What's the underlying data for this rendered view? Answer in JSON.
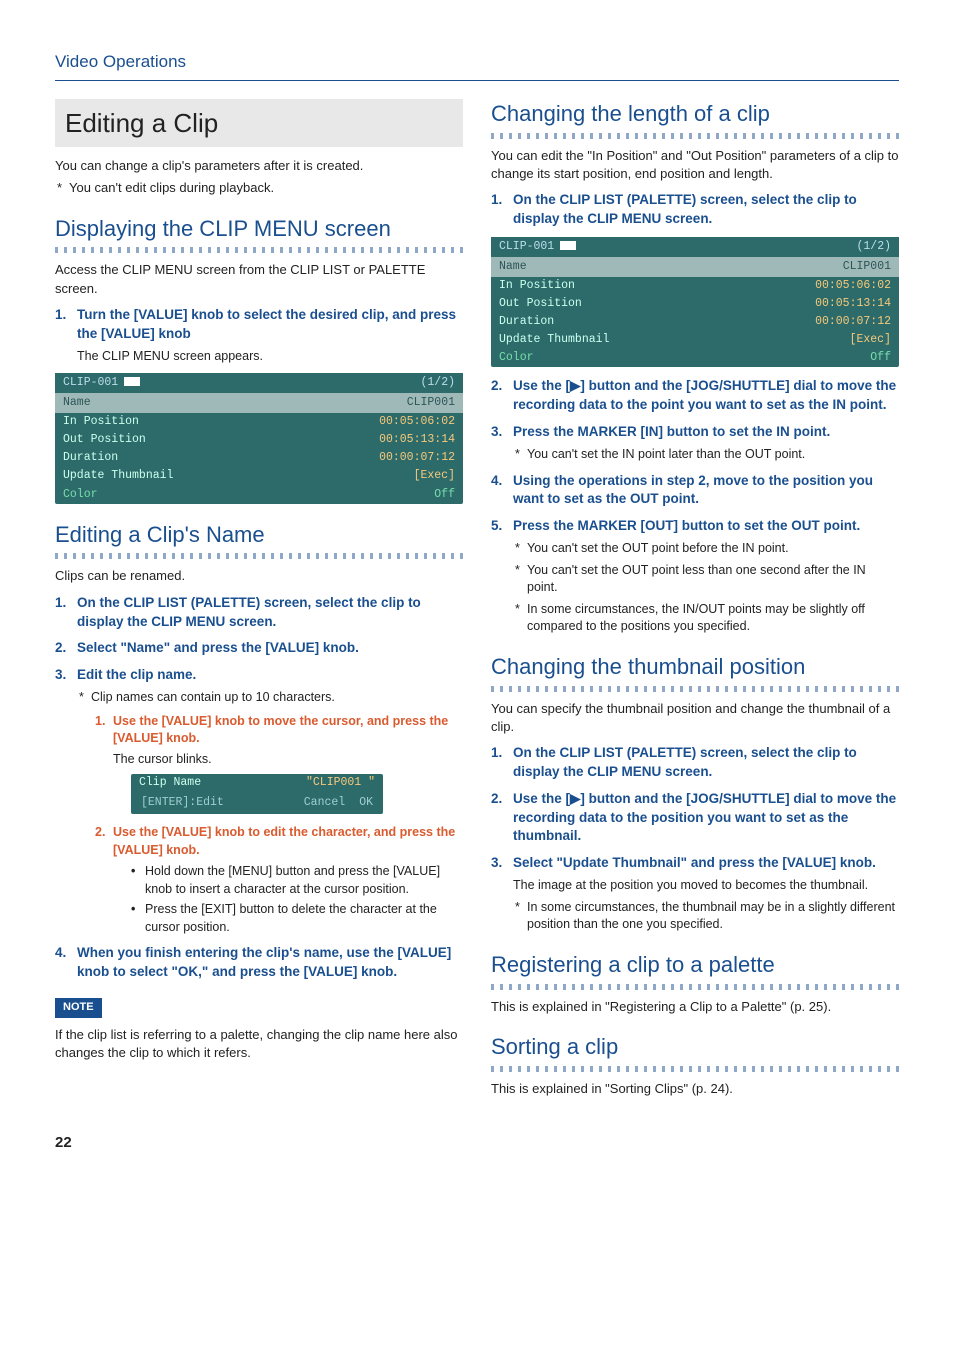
{
  "breadcrumb": "Video Operations",
  "h1": "Editing a Clip",
  "intro": "You can change a clip's parameters after it is created.",
  "intro_note": "You can't edit clips during playback.",
  "sec_display": {
    "title": "Displaying the CLIP MENU screen",
    "body": "Access the CLIP MENU screen from the CLIP LIST or PALETTE screen.",
    "step1": "Turn the [VALUE] knob to select the desired clip, and press the [VALUE] knob",
    "step1_sub": "The CLIP MENU screen appears."
  },
  "clipmenu": {
    "hdr_left": "CLIP-001",
    "hdr_right": "(1/2)",
    "name_l": "Name",
    "name_r": "CLIP001",
    "rows": [
      {
        "l": "In Position",
        "r": "00:05:06:02"
      },
      {
        "l": "Out Position",
        "r": "00:05:13:14"
      },
      {
        "l": "Duration",
        "r": "00:00:07:12"
      },
      {
        "l": "Update Thumbnail",
        "r": "[Exec]"
      },
      {
        "l": "Color",
        "r": "Off"
      }
    ]
  },
  "sec_name": {
    "title": "Editing a Clip's Name",
    "body": "Clips can be renamed.",
    "steps": [
      "On the CLIP LIST (PALETTE) screen, select the clip to display the CLIP MENU screen.",
      "Select \"Name\" and press the [VALUE] knob.",
      "Edit the clip name."
    ],
    "step3_note": "Clip names can contain up to 10 characters.",
    "sub1": "Use the [VALUE] knob to move the cursor, and press the [VALUE] knob.",
    "sub1_body": "The cursor blinks.",
    "sub2": "Use the [VALUE] knob to edit the character, and press the [VALUE] knob.",
    "sub2_b1": "Hold down the [MENU] button and press the [VALUE] knob to insert a character at the cursor position.",
    "sub2_b2": "Press the [EXIT] button to delete the character at the cursor position.",
    "step4": "When you finish entering the clip's name, use the [VALUE] knob to select \"OK,\" and press the [VALUE] knob.",
    "note_body": "If the clip list is referring to a palette, changing the clip name here also changes the clip to which it refers."
  },
  "nameedit": {
    "row_l": "Clip Name",
    "row_r": "\"CLIP001   \"",
    "btn_left": "[ENTER]:Edit",
    "btn_cancel": "Cancel",
    "btn_ok": "OK"
  },
  "sec_len": {
    "title": "Changing the length of a clip",
    "body": "You can edit the \"In Position\" and \"Out Position\" parameters of a clip to change its start position, end position and length.",
    "s1": "On the CLIP LIST (PALETTE) screen, select the clip to display the CLIP MENU screen.",
    "s2": "Use the [▶] button and the [JOG/SHUTTLE] dial to move the recording data to the point you want to set as the IN point.",
    "s3": "Press the MARKER [IN] button to set the IN point.",
    "s3_note": "You can't set the IN point later than the OUT point.",
    "s4": "Using the operations in step 2, move to the position you want to set as the OUT point.",
    "s5": "Press the MARKER [OUT] button to set the OUT point.",
    "s5_n1": "You can't set the OUT point before the IN point.",
    "s5_n2": "You can't set the OUT point less than one second after the IN point.",
    "s5_n3": "In some circumstances, the IN/OUT points may be slightly off compared to the positions you specified."
  },
  "sec_thumb": {
    "title": "Changing the thumbnail position",
    "body": "You can specify the thumbnail position and change the thumbnail of a clip.",
    "s1": "On the CLIP LIST (PALETTE) screen, select the clip to display the CLIP MENU screen.",
    "s2": "Use the [▶] button and the [JOG/SHUTTLE] dial to move the recording data to the position you want to set as the thumbnail.",
    "s3": "Select \"Update Thumbnail\" and press the [VALUE] knob.",
    "s3_body": "The image at the position you moved to becomes the thumbnail.",
    "s3_note": "In some circumstances, the thumbnail may be in a slightly different position than the one you specified."
  },
  "sec_reg": {
    "title": "Registering a clip to a palette",
    "body": "This is explained in \"Registering a Clip to a Palette\" (p. 25)."
  },
  "sec_sort": {
    "title": "Sorting a clip",
    "body": "This is explained in \"Sorting Clips\" (p. 24)."
  },
  "note_label": "NOTE",
  "pagenum": "22"
}
